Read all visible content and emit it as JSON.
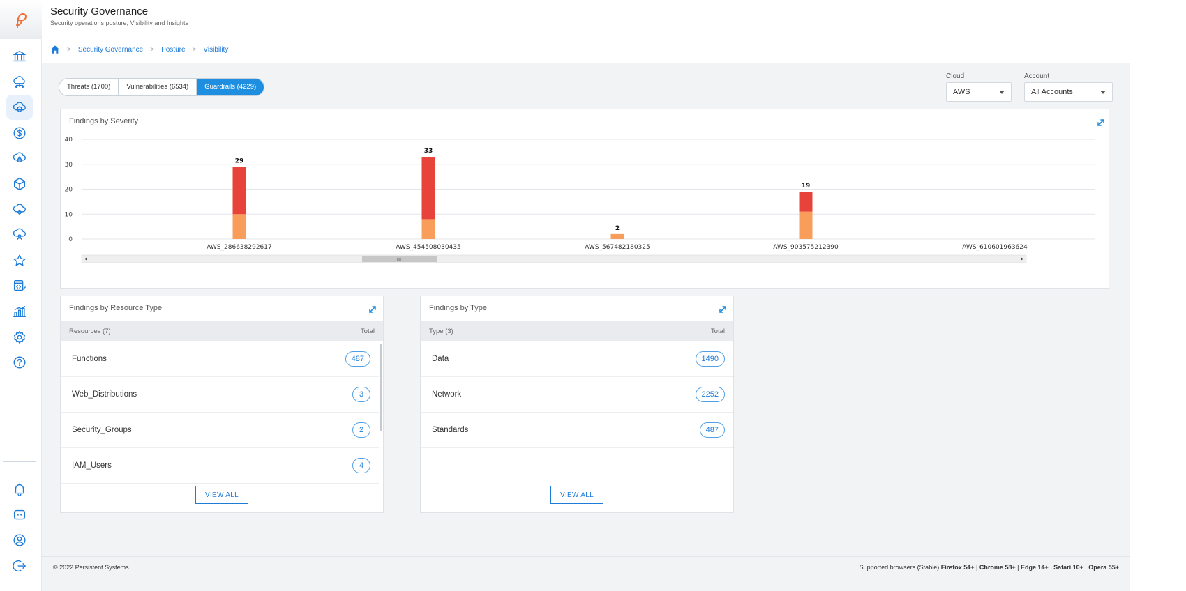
{
  "app": {
    "title": "Security Governance",
    "subtitle": "Security operations posture, Visibility and Insights"
  },
  "breadcrumb": [
    "Security Governance",
    "Posture",
    "Visibility"
  ],
  "sidebar": {
    "items": [
      {
        "icon": "bank-icon"
      },
      {
        "icon": "cloud-network-icon"
      },
      {
        "icon": "cloud-shield-icon",
        "active": true
      },
      {
        "icon": "dollar-circle-icon"
      },
      {
        "icon": "cloud-lock-icon"
      },
      {
        "icon": "cube-icon"
      },
      {
        "icon": "cloud-gear-icon"
      },
      {
        "icon": "cloud-users-icon"
      },
      {
        "icon": "star-icon"
      },
      {
        "icon": "code-edit-icon"
      },
      {
        "icon": "analytics-icon"
      },
      {
        "icon": "settings-icon"
      },
      {
        "icon": "help-icon"
      }
    ],
    "bottom_items": [
      {
        "icon": "bell-icon"
      },
      {
        "icon": "chat-icon"
      },
      {
        "icon": "user-icon"
      },
      {
        "icon": "logout-icon"
      }
    ]
  },
  "tabs": [
    {
      "label": "Threats (1700)",
      "active": false
    },
    {
      "label": "Vulnerabilities (6534)",
      "active": false
    },
    {
      "label": "Guardrails (4229)",
      "active": true
    }
  ],
  "filters": {
    "cloud": {
      "label": "Cloud",
      "value": "AWS"
    },
    "account": {
      "label": "Account",
      "value": "All Accounts"
    }
  },
  "severity_card": {
    "title": "Findings by Severity",
    "scroll_thumb": "III"
  },
  "chart_data": {
    "type": "bar",
    "stacked": true,
    "categories": [
      "AWS_286638292617",
      "AWS_454508030435",
      "AWS_567482180325",
      "AWS_903575212390",
      "AWS_610601963624"
    ],
    "series": [
      {
        "values": [
          10,
          8,
          2,
          11,
          0
        ],
        "color": "#f99d5b"
      },
      {
        "values": [
          19,
          25,
          0,
          8,
          0
        ],
        "color": "#e8433a"
      }
    ],
    "totals": [
      "29",
      "33",
      "2",
      "19",
      ""
    ],
    "yticks": [
      "0",
      "10",
      "20",
      "30",
      "40"
    ],
    "ylim": [
      0,
      40
    ],
    "grid": true
  },
  "resource_card": {
    "title": "Findings by Resource Type",
    "header_left": "Resources (7)",
    "header_right": "Total",
    "rows": [
      {
        "label": "Functions",
        "total": "487"
      },
      {
        "label": "Web_Distributions",
        "total": "3"
      },
      {
        "label": "Security_Groups",
        "total": "2"
      },
      {
        "label": "IAM_Users",
        "total": "4"
      }
    ],
    "button": "VIEW ALL"
  },
  "type_card": {
    "title": "Findings by Type",
    "header_left": "Type (3)",
    "header_right": "Total",
    "rows": [
      {
        "label": "Data",
        "total": "1490"
      },
      {
        "label": "Network",
        "total": "2252"
      },
      {
        "label": "Standards",
        "total": "487"
      }
    ],
    "button": "VIEW ALL"
  },
  "footer": {
    "copyright": "© 2022 Persistent Systems",
    "supported_prefix": "Supported browsers (Stable)",
    "browsers": [
      "Firefox 54+",
      "Chrome 58+",
      "Edge 14+",
      "Safari 10+",
      "Opera 55+"
    ]
  },
  "colors": {
    "accent": "#1e8fe0",
    "link": "#1e7bd8",
    "bar_low": "#f99d5b",
    "bar_high": "#e8433a",
    "logo": "#f0703a"
  }
}
